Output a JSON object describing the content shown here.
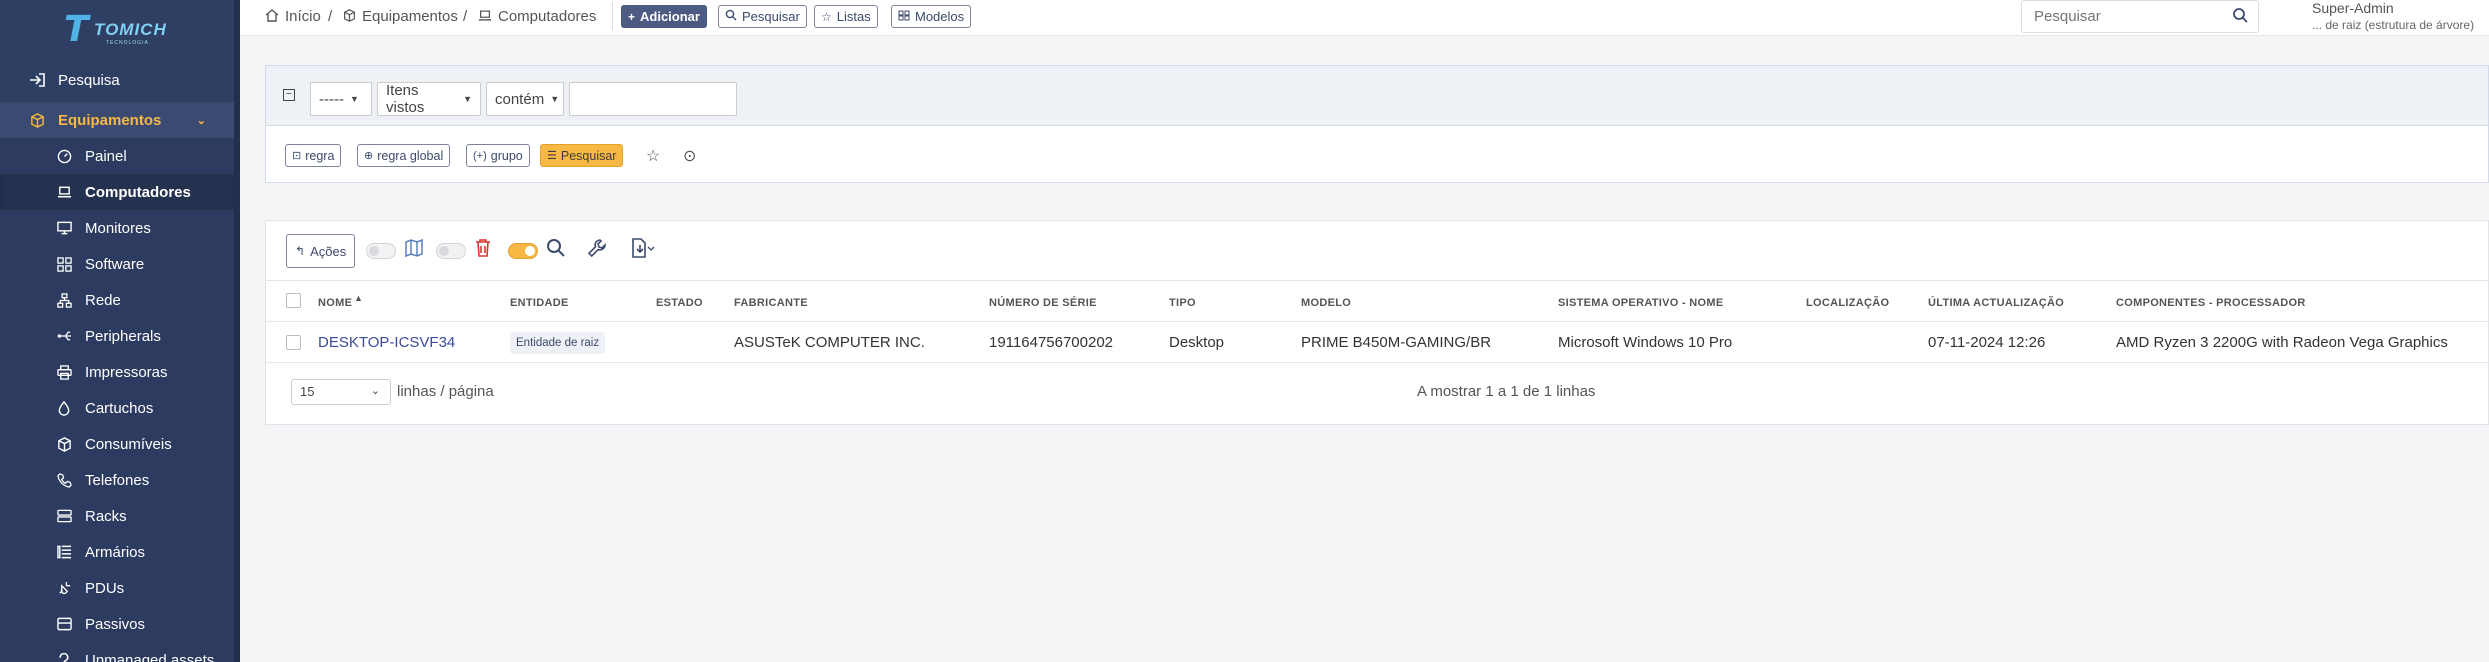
{
  "sidebar": {
    "logo_text": "TOMICH",
    "logo_sub": "TECNOLOGIA",
    "top_item": "Pesquisa",
    "section": "Equipamentos",
    "items": [
      {
        "label": "Painel",
        "icon": "dashboard-icon"
      },
      {
        "label": "Computadores",
        "icon": "laptop-icon"
      },
      {
        "label": "Monitores",
        "icon": "monitor-icon"
      },
      {
        "label": "Software",
        "icon": "software-icon"
      },
      {
        "label": "Rede",
        "icon": "network-icon"
      },
      {
        "label": "Peripherals",
        "icon": "peripherals-icon"
      },
      {
        "label": "Impressoras",
        "icon": "printer-icon"
      },
      {
        "label": "Cartuchos",
        "icon": "cartridge-icon"
      },
      {
        "label": "Consumíveis",
        "icon": "box-icon"
      },
      {
        "label": "Telefones",
        "icon": "phone-icon"
      },
      {
        "label": "Racks",
        "icon": "rack-icon"
      },
      {
        "label": "Armários",
        "icon": "cabinet-icon"
      },
      {
        "label": "PDUs",
        "icon": "plug-icon"
      },
      {
        "label": "Passivos",
        "icon": "passive-icon"
      },
      {
        "label": "Unmanaged assets",
        "icon": "question-icon"
      }
    ]
  },
  "breadcrumb": {
    "home": "Início",
    "section": "Equipamentos",
    "page": "Computadores"
  },
  "toolbar": {
    "add": "Adicionar",
    "search": "Pesquisar",
    "lists": "Listas",
    "models": "Modelos"
  },
  "global_search": {
    "placeholder": "Pesquisar"
  },
  "user": {
    "name": "Super-Admin",
    "entity": "... de raiz (estrutura de árvore)"
  },
  "filter": {
    "field": "-----",
    "scope": "Itens vistos",
    "operator": "contém",
    "value": "",
    "rule": "regra",
    "global_rule": "regra global",
    "group": "grupo",
    "search": "Pesquisar"
  },
  "results": {
    "actions": "Ações",
    "columns": [
      "NOME",
      "ENTIDADE",
      "ESTADO",
      "FABRICANTE",
      "NÚMERO DE SÉRIE",
      "TIPO",
      "MODELO",
      "SISTEMA OPERATIVO - NOME",
      "LOCALIZAÇÃO",
      "ÚLTIMA ACTUALIZAÇÃO",
      "COMPONENTES - PROCESSADOR"
    ],
    "rows": [
      {
        "name": "DESKTOP-ICSVF34",
        "entity": "Entidade de raiz",
        "status": "",
        "manufacturer": "ASUSTeK COMPUTER INC.",
        "serial": "191164756700202",
        "type": "Desktop",
        "model": "PRIME B450M-GAMING/BR",
        "os": "Microsoft Windows 10 Pro",
        "location": "",
        "updated": "07-11-2024 12:26",
        "processor": "AMD Ryzen 3 2200G with Radeon Vega Graphics"
      }
    ],
    "per_page": "15",
    "per_page_label": "linhas / página",
    "info": "A mostrar 1 a 1 de 1 linhas"
  },
  "colors": {
    "sidebar": "#2f3f64",
    "accent": "#f7b944",
    "primary": "#4d5b82"
  }
}
